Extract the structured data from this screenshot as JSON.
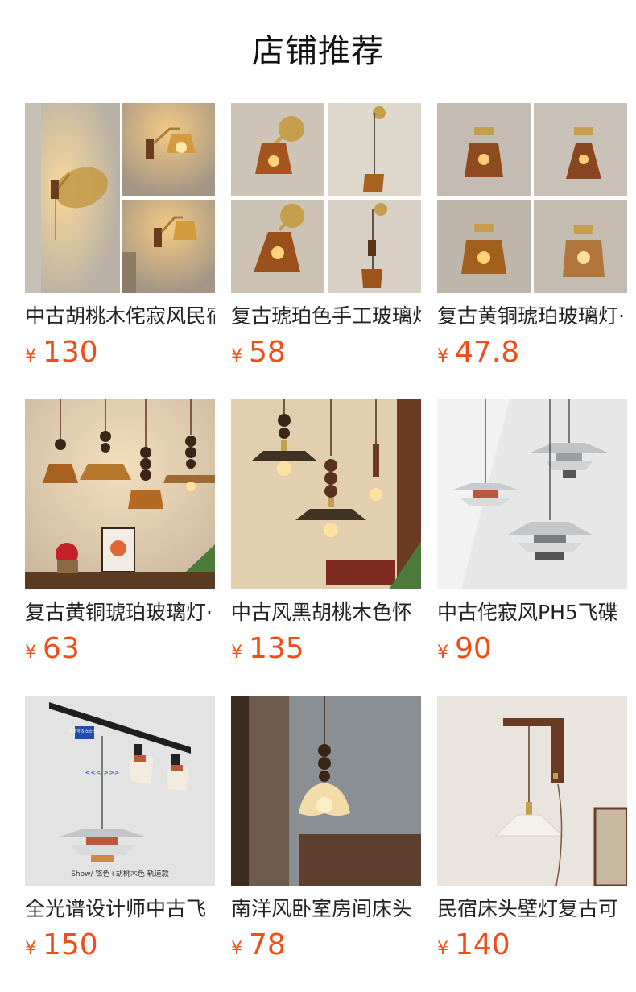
{
  "header": {
    "title": "店铺推荐"
  },
  "currency_symbol": "¥",
  "colors": {
    "price": "#f04e16",
    "title": "#111111",
    "text": "#222222"
  },
  "products": [
    {
      "name": "中古胡桃木侘寂风民宿",
      "price": "130",
      "image": "walnut-amber-wall-lamp-collage"
    },
    {
      "name": "复古琥珀色手工玻璃灯",
      "price": "58",
      "image": "amber-glass-brass-wall-lamp-collage"
    },
    {
      "name": "复古黄铜琥珀玻璃灯·",
      "price": "47.8",
      "image": "brass-amber-ceiling-lamp-collage"
    },
    {
      "name": "复古黄铜琥珀玻璃灯·",
      "price": "63",
      "image": "amber-glass-pendant-lamps-shelf"
    },
    {
      "name": "中古风黑胡桃木色怀",
      "price": "135",
      "image": "walnut-bead-dark-shade-pendants"
    },
    {
      "name": "中古侘寂风PH5飞碟",
      "price": "90",
      "image": "ph5-ufo-chrome-pendants"
    },
    {
      "name": "全光谱设计师中古飞",
      "price": "150",
      "image": "track-light-ph5-pendant",
      "image_caption": "Show/ 铬色+胡桃木色 轨道款",
      "image_badge": "轨道可选 左右移动",
      "image_arrows": "<<<  >>>"
    },
    {
      "name": "南洋风卧室房间床头",
      "price": "78",
      "image": "flower-shade-bead-pendant"
    },
    {
      "name": "民宿床头壁灯复古可",
      "price": "140",
      "image": "pleated-shade-wooden-arm-wall-lamp"
    }
  ]
}
